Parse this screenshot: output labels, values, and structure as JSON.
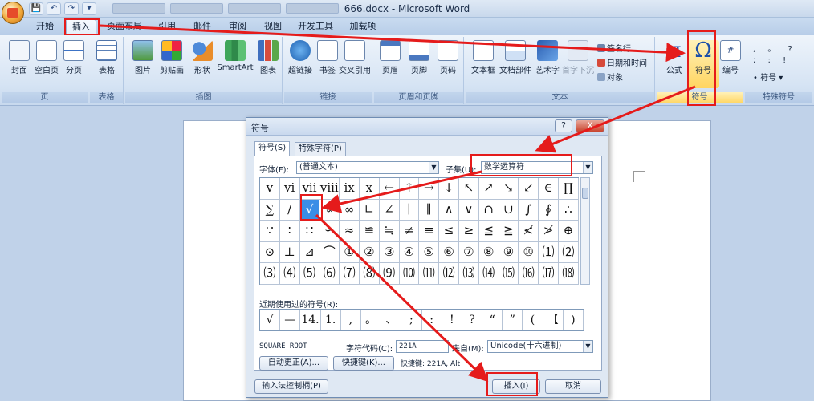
{
  "window": {
    "title": "666.docx - Microsoft Word"
  },
  "qat": [
    "💾",
    "↶",
    "↷",
    "▾"
  ],
  "tabs": [
    "开始",
    "插入",
    "页面布局",
    "引用",
    "邮件",
    "审阅",
    "视图",
    "开发工具",
    "加载项"
  ],
  "ribbon": {
    "groups": {
      "page": {
        "label": "页",
        "buttons": [
          "封面",
          "空白页",
          "分页"
        ]
      },
      "table": {
        "label": "表格",
        "buttons": [
          "表格"
        ]
      },
      "illustrations": {
        "label": "插图",
        "buttons": [
          "图片",
          "剪贴画",
          "形状",
          "SmartArt",
          "图表"
        ]
      },
      "links": {
        "label": "链接",
        "buttons": [
          "超链接",
          "书签",
          "交叉引用"
        ]
      },
      "header_footer": {
        "label": "页眉和页脚",
        "buttons": [
          "页眉",
          "页脚",
          "页码"
        ]
      },
      "text": {
        "label": "文本",
        "buttons": [
          "文本框",
          "文档部件",
          "艺术字",
          "首字下沉"
        ],
        "small": [
          "签名行",
          "日期和时间",
          "对象"
        ]
      },
      "symbols": {
        "label": "符号",
        "buttons": [
          "公式",
          "符号",
          "编号"
        ]
      },
      "special": {
        "label": "特殊符号",
        "small": [
          "符号"
        ]
      }
    }
  },
  "dialog": {
    "title": "符号",
    "help": "?",
    "close": "X",
    "tabs": [
      "符号(S)",
      "特殊字符(P)"
    ],
    "font_label": "字体(F):",
    "font_value": "(普通文本)",
    "subset_label": "子集(U):",
    "subset_value": "数学运算符",
    "grid": [
      [
        "v",
        "vi",
        "vii",
        "viii",
        "ix",
        "x",
        "←",
        "↑",
        "→",
        "↓",
        "↖",
        "↗",
        "↘",
        "↙",
        "∈",
        "∏"
      ],
      [
        "∑",
        "/",
        "√",
        "∝",
        "∞",
        "∟",
        "∠",
        "∣",
        "∥",
        "∧",
        "∨",
        "∩",
        "∪",
        "∫",
        "∮",
        "∴"
      ],
      [
        "∵",
        "∶",
        "∷",
        "∽",
        "≈",
        "≌",
        "≒",
        "≠",
        "≡",
        "≤",
        "≥",
        "≦",
        "≧",
        "≮",
        "≯",
        "⊕"
      ],
      [
        "⊙",
        "⊥",
        "⊿",
        "⌒",
        "①",
        "②",
        "③",
        "④",
        "⑤",
        "⑥",
        "⑦",
        "⑧",
        "⑨",
        "⑩",
        "⑴",
        "⑵"
      ],
      [
        "⑶",
        "⑷",
        "⑸",
        "⑹",
        "⑺",
        "⑻",
        "⑼",
        "⑽",
        "⑾",
        "⑿",
        "⒀",
        "⒁",
        "⒂",
        "⒃",
        "⒄",
        "⒅"
      ]
    ],
    "recent_label": "近期使用过的符号(R):",
    "recent": [
      "√",
      "—",
      "14.",
      "1.",
      ",",
      "。",
      "、",
      ";",
      ":",
      "!",
      "?",
      "“",
      "”",
      "(",
      "【",
      ")"
    ],
    "char_name": "SQUARE ROOT",
    "code_label": "字符代码(C):",
    "code_value": "221A",
    "from_label": "来自(M):",
    "from_value": "Unicode(十六进制)",
    "autocorrect": "自动更正(A)...",
    "shortcut_btn": "快捷键(K)...",
    "shortcut_text": "快捷键: 221A, Alt",
    "ime": "输入法控制柄(P)",
    "insert": "插入(I)",
    "cancel": "取消"
  },
  "colors": {
    "annotation": "#e51b1b",
    "selected": "#3a8ee6"
  }
}
